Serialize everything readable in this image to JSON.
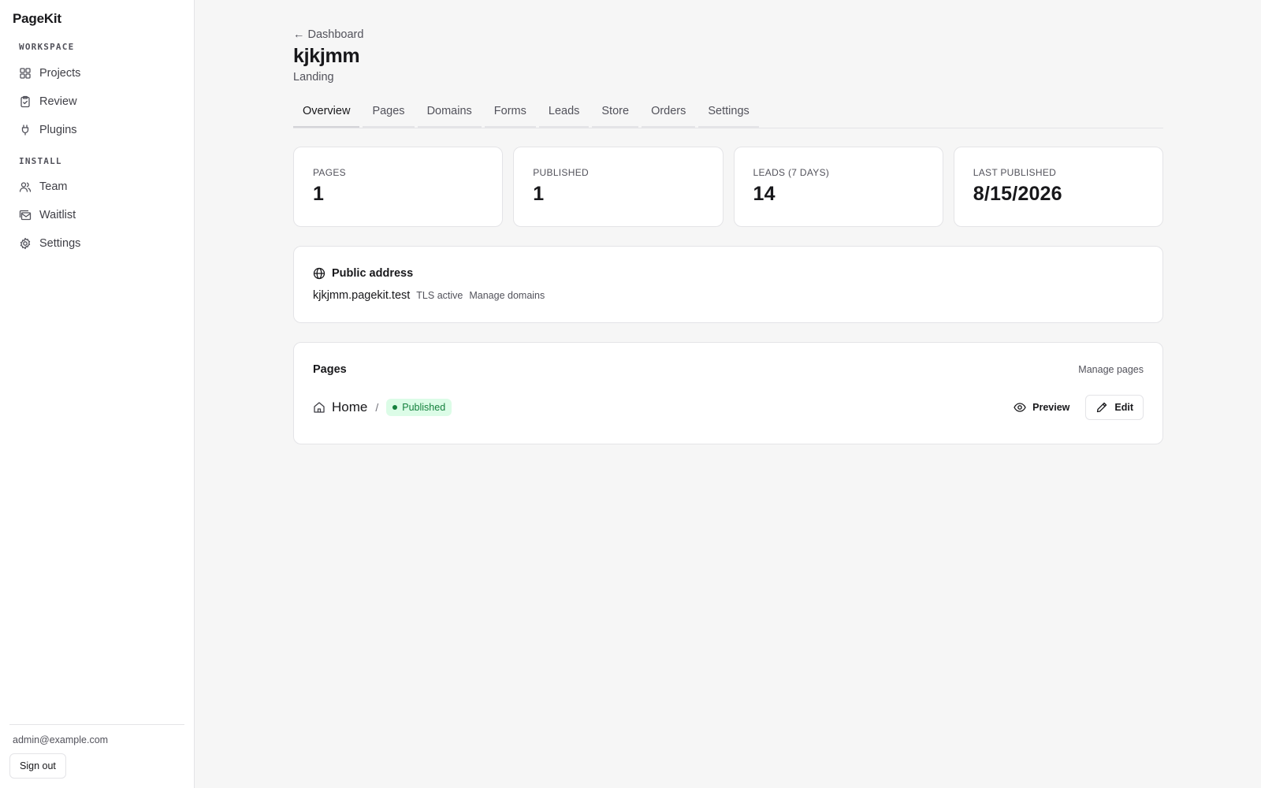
{
  "app": {
    "brand": "PageKit"
  },
  "sidebar": {
    "sections": [
      {
        "label": "WORKSPACE",
        "items": [
          {
            "label": "Projects",
            "icon": "grid-icon"
          },
          {
            "label": "Review",
            "icon": "clipboard-check-icon"
          },
          {
            "label": "Plugins",
            "icon": "plug-icon"
          }
        ]
      },
      {
        "label": "INSTALL",
        "items": [
          {
            "label": "Team",
            "icon": "users-icon"
          },
          {
            "label": "Waitlist",
            "icon": "mail-stack-icon"
          },
          {
            "label": "Settings",
            "icon": "gear-icon"
          }
        ]
      }
    ],
    "user_email": "admin@example.com",
    "sign_out_label": "Sign out"
  },
  "header": {
    "back_label": "Dashboard",
    "back_arrow": "←",
    "title": "kjkjmm",
    "subtitle": "Landing"
  },
  "tabs": [
    "Overview",
    "Pages",
    "Domains",
    "Forms",
    "Leads",
    "Store",
    "Orders",
    "Settings"
  ],
  "active_tab": "Overview",
  "stats": [
    {
      "label": "PAGES",
      "value": "1"
    },
    {
      "label": "PUBLISHED",
      "value": "1"
    },
    {
      "label": "LEADS (7 DAYS)",
      "value": "14"
    },
    {
      "label": "LAST PUBLISHED",
      "value": "8/15/2026"
    }
  ],
  "public_address": {
    "title": "Public address",
    "domain": "kjkjmm.pagekit.test",
    "tls_status": "TLS active",
    "manage_label": "Manage domains"
  },
  "pages_card": {
    "title": "Pages",
    "manage_label": "Manage pages",
    "rows": [
      {
        "name": "Home",
        "separator": "/",
        "status": "Published",
        "preview_label": "Preview",
        "edit_label": "Edit"
      }
    ]
  },
  "colors": {
    "accent_green": "#15803d",
    "badge_bg": "#dcfce7",
    "border": "#e4e4e7",
    "page_bg": "#f6f6f6"
  }
}
